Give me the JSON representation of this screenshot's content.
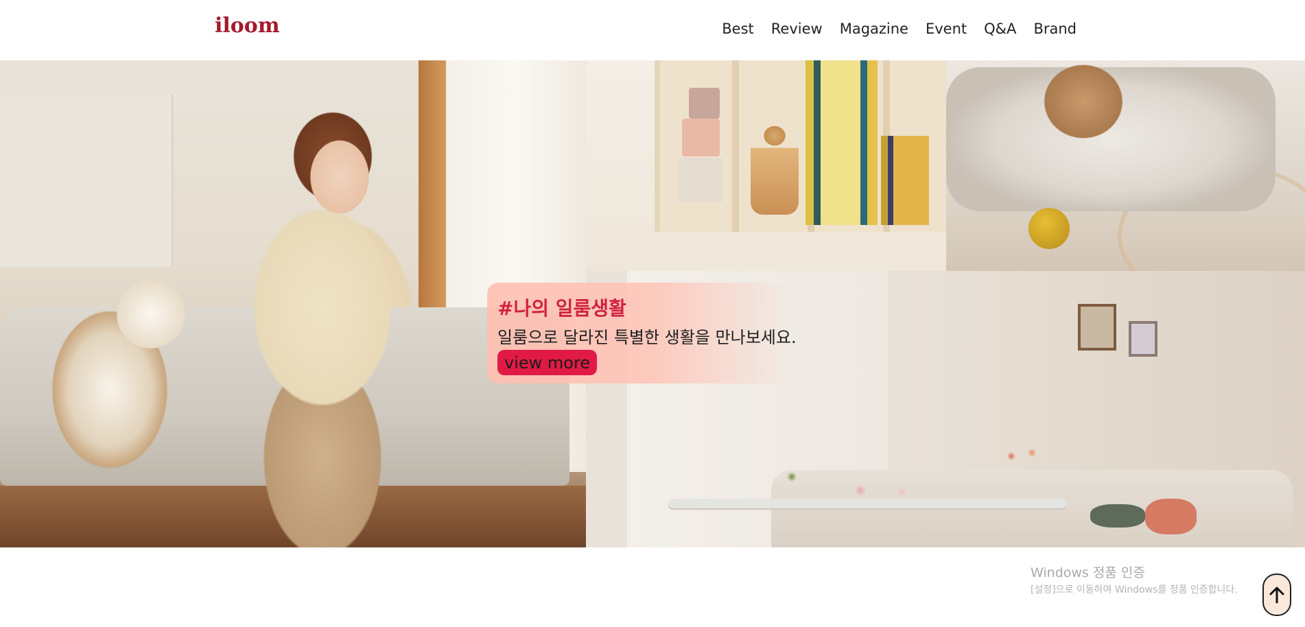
{
  "header": {
    "logo": "iloom",
    "nav": [
      {
        "label": "Best"
      },
      {
        "label": "Review"
      },
      {
        "label": "Magazine"
      },
      {
        "label": "Event"
      },
      {
        "label": "Q&A"
      },
      {
        "label": "Brand"
      }
    ]
  },
  "hero": {
    "promo": {
      "title": "#나의 일룸생활",
      "subtitle": "일룸으로 달라진 특별한 생활을 만나보세요.",
      "button_label": "view more"
    }
  },
  "watermark": {
    "title": "Windows 정품 인증",
    "subtitle": "[설정]으로 이동하여 Windows를 정품 인증합니다."
  },
  "scroll_top": {
    "icon": "arrow-up-icon"
  },
  "colors": {
    "brand": "#a5192e",
    "accent": "#e11a45",
    "promo_title": "#d0223f"
  }
}
